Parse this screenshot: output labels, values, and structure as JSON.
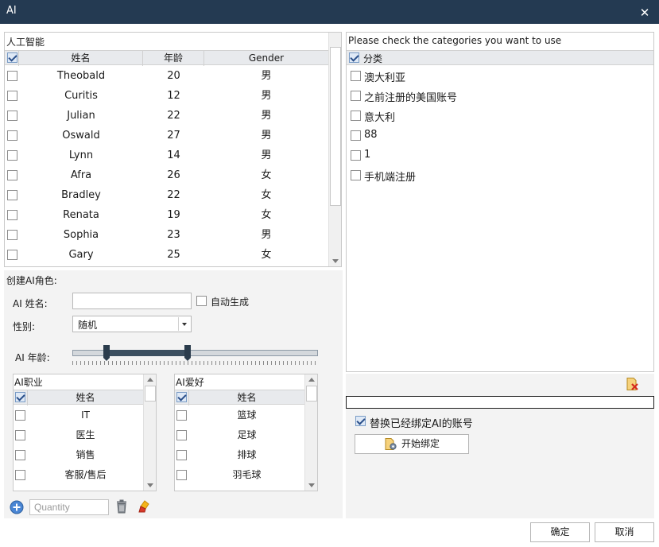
{
  "window": {
    "title": "AI"
  },
  "ai_grid": {
    "caption": "人工智能",
    "headers": {
      "name": "姓名",
      "age": "年龄",
      "gender": "Gender"
    },
    "rows": [
      {
        "name": "Theobald",
        "age": "20",
        "gender": "男"
      },
      {
        "name": "Curitis",
        "age": "12",
        "gender": "男"
      },
      {
        "name": "Julian",
        "age": "22",
        "gender": "男"
      },
      {
        "name": "Oswald",
        "age": "27",
        "gender": "男"
      },
      {
        "name": "Lynn",
        "age": "14",
        "gender": "男"
      },
      {
        "name": "Afra",
        "age": "26",
        "gender": "女"
      },
      {
        "name": "Bradley",
        "age": "22",
        "gender": "女"
      },
      {
        "name": "Renata",
        "age": "19",
        "gender": "女"
      },
      {
        "name": "Sophia",
        "age": "23",
        "gender": "男"
      },
      {
        "name": "Gary",
        "age": "25",
        "gender": "女"
      }
    ]
  },
  "create": {
    "title": "创建AI角色:",
    "name_label": "AI 姓名:",
    "name_value": "",
    "auto_generate_label": "自动生成",
    "gender_label": "性别:",
    "gender_value": "随机",
    "age_label": "AI 年龄:",
    "age_slider": {
      "low_fraction": 0.14,
      "high_fraction": 0.47
    }
  },
  "job_grid": {
    "caption": "AI职业",
    "header": "姓名",
    "rows": [
      "IT",
      "医生",
      "销售",
      "客服/售后"
    ]
  },
  "hobby_grid": {
    "caption": "AI爱好",
    "header": "姓名",
    "rows": [
      "篮球",
      "足球",
      "排球",
      "羽毛球"
    ]
  },
  "toolbar": {
    "quantity_placeholder": "Quantity",
    "icons": [
      "add-circle-icon",
      "trash-icon",
      "eraser-icon"
    ]
  },
  "categories": {
    "prompt": "Please check the categories you want to use",
    "header": "分类",
    "items": [
      "澳大利亚",
      "之前注册的美国账号",
      "意大利",
      "88",
      "1",
      "手机端注册"
    ]
  },
  "bind": {
    "replace_label": "替换已经绑定AI的账号",
    "replace_checked": true,
    "start_label": "开始绑定",
    "progress": 0
  },
  "footer": {
    "ok_label": "确定",
    "cancel_label": "取消"
  },
  "colors": {
    "titlebar": "#243a52",
    "panel": "#f3f3f3",
    "slider_range": "#3c4f60"
  }
}
